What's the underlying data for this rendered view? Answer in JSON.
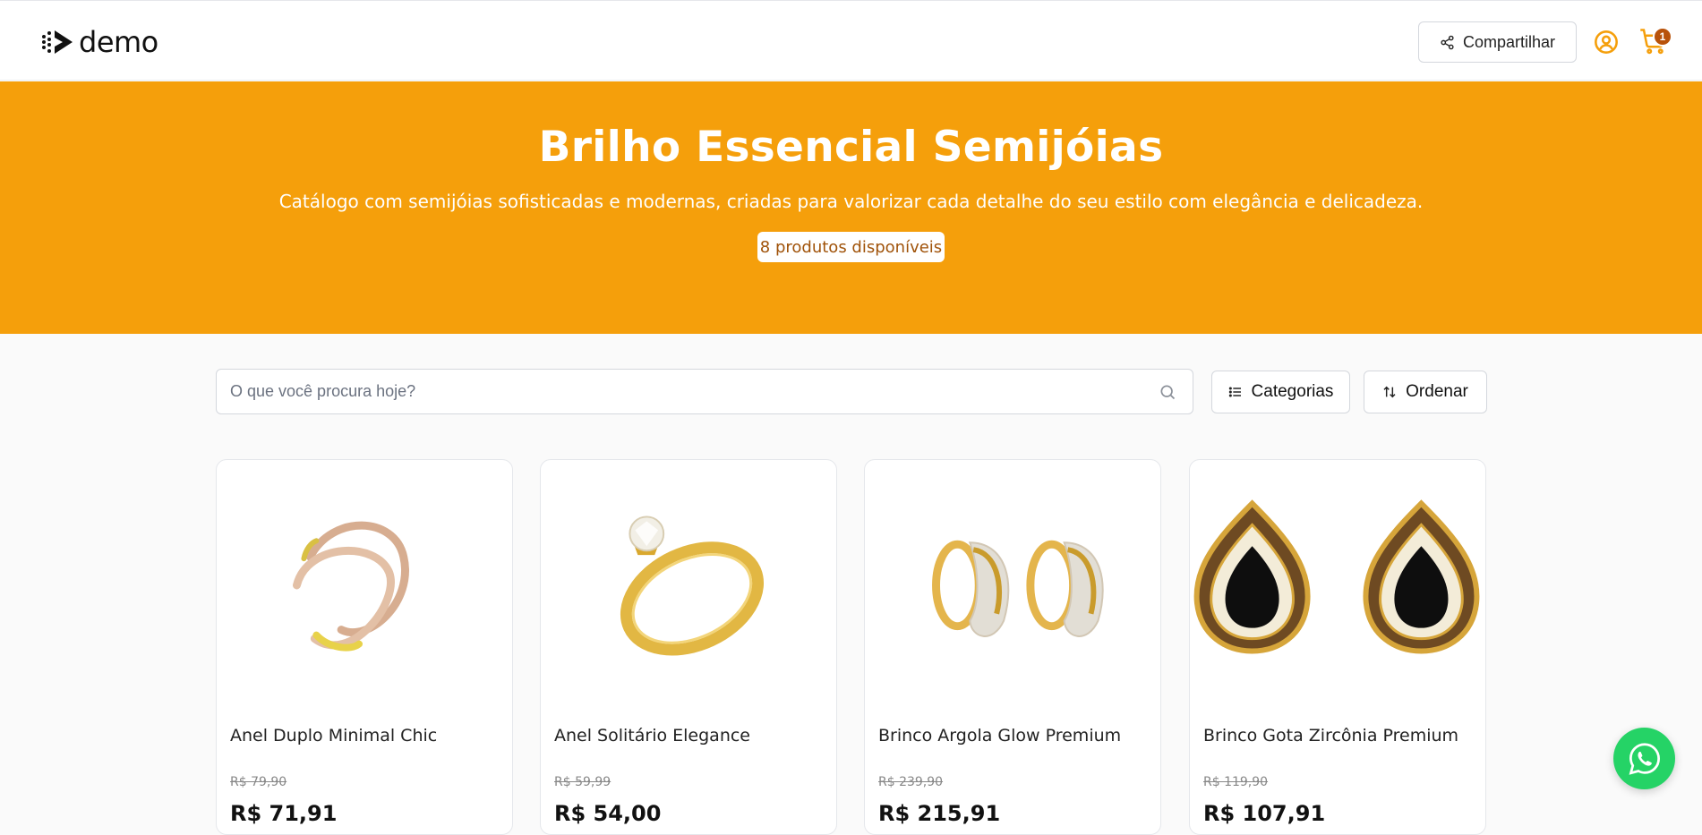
{
  "brand": {
    "logo_text": "demo",
    "accent": "#f59f0b",
    "cart_badge_color": "#b8520a"
  },
  "header": {
    "share_label": "Compartilhar",
    "share_icon": "share-icon",
    "user_icon": "user-circle-icon",
    "cart_icon": "cart-icon",
    "cart_count": "1"
  },
  "hero": {
    "title": "Brilho Essencial Semijóias",
    "description": "Catálogo com semijóias sofisticadas e modernas, criadas para valorizar cada detalhe do seu estilo com elegância e delicadeza.",
    "count_badge": "8 produtos disponíveis"
  },
  "search": {
    "placeholder": "O que você procura hoje?",
    "value": "",
    "icon": "search-icon"
  },
  "controls": {
    "categories_label": "Categorias",
    "sort_label": "Ordenar"
  },
  "products": [
    {
      "name": "Anel Duplo Minimal Chic",
      "old_price": "R$ 79,90",
      "price": "R$ 71,91"
    },
    {
      "name": "Anel Solitário Elegance",
      "old_price": "R$ 59,99",
      "price": "R$ 54,00"
    },
    {
      "name": "Brinco Argola Glow Premium",
      "old_price": "R$ 239,90",
      "price": "R$ 215,91"
    },
    {
      "name": "Brinco Gota Zircônia Premium",
      "old_price": "R$ 119,90",
      "price": "R$ 107,91"
    }
  ],
  "floating": {
    "whatsapp_icon": "whatsapp-icon",
    "whatsapp_color": "#25d366"
  }
}
